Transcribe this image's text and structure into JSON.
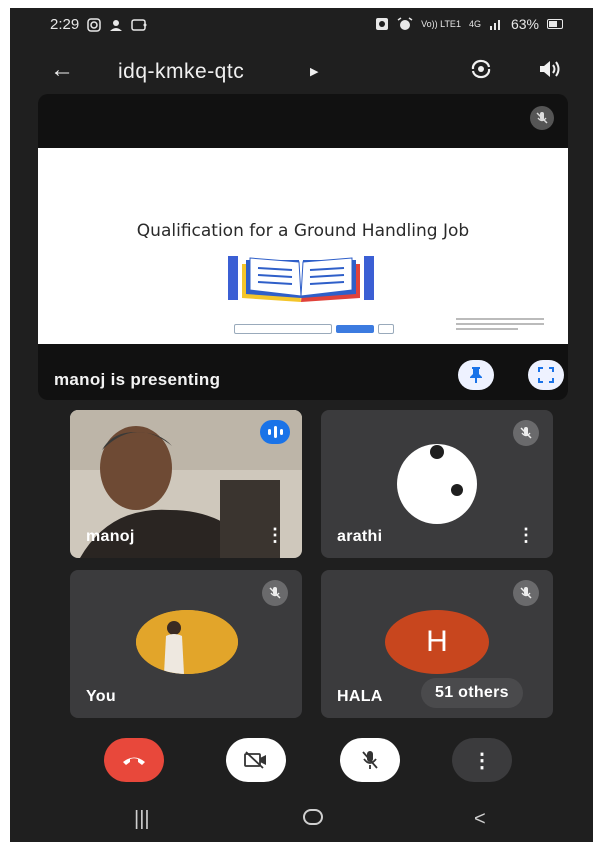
{
  "status_bar": {
    "time": "2:29",
    "network": "Vo)) LTE1",
    "network_gen": "4G",
    "battery": "63%"
  },
  "app_bar": {
    "meeting_code": "idq-kmke-qtc"
  },
  "presentation": {
    "slide_title": "Qualification for a Ground Handling Job",
    "presenting_label": "manoj is presenting"
  },
  "participants": [
    {
      "name": "manoj",
      "speaking": true
    },
    {
      "name": "arathi",
      "muted": true
    },
    {
      "name": "You",
      "muted": true
    },
    {
      "name": "HALA",
      "initial": "H",
      "muted": true,
      "avatar_color": "#c8461e"
    }
  ],
  "others_chip": "51 others",
  "colors": {
    "end_call": "#e8483b",
    "speaking_badge": "#1a73e8",
    "tile_bg": "#3b3b3d",
    "screen_bg": "#1f1f1f"
  },
  "icons": [
    "back-arrow-icon",
    "camera-flip-icon",
    "speaker-icon",
    "mic-off-icon",
    "pin-icon",
    "fullscreen-icon",
    "more-vert-icon",
    "end-call-icon",
    "video-off-icon"
  ]
}
